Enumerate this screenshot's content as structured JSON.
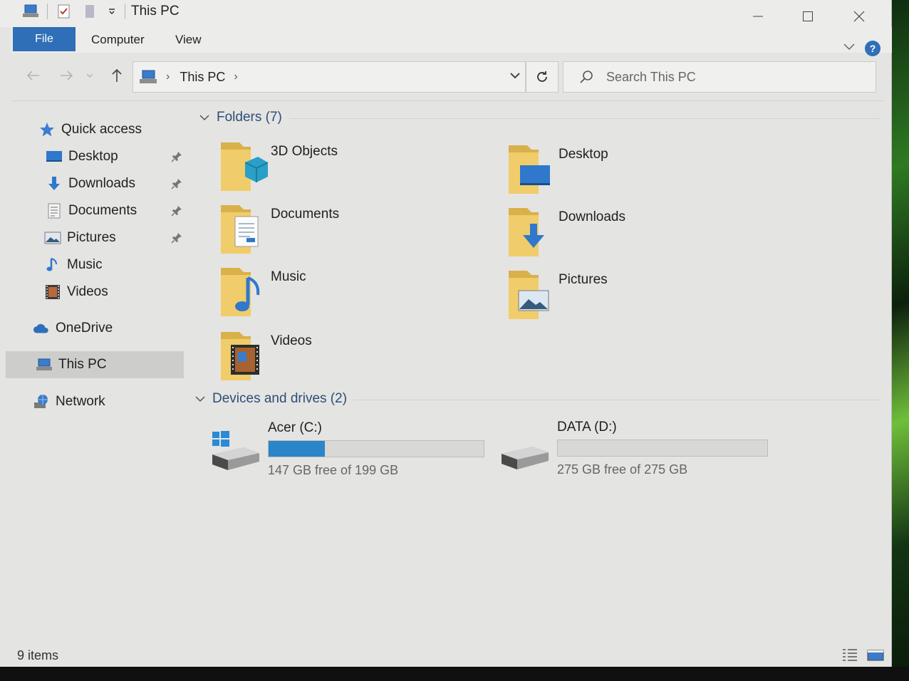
{
  "window": {
    "title": "This PC",
    "controls": {
      "minimize": "─",
      "maximize": "☐",
      "close": "✕"
    }
  },
  "ribbon": {
    "tabs": [
      {
        "label": "File"
      },
      {
        "label": "Computer"
      },
      {
        "label": "View"
      }
    ],
    "help": "?"
  },
  "address": {
    "path": "This PC",
    "search_placeholder": "Search This PC"
  },
  "navpane": {
    "quick_access": "Quick access",
    "items": [
      {
        "label": "Desktop",
        "pinned": true
      },
      {
        "label": "Downloads",
        "pinned": true
      },
      {
        "label": "Documents",
        "pinned": true
      },
      {
        "label": "Pictures",
        "pinned": true
      },
      {
        "label": "Music",
        "pinned": false
      },
      {
        "label": "Videos",
        "pinned": false
      }
    ],
    "onedrive": "OneDrive",
    "this_pc": "This PC",
    "network": "Network"
  },
  "content": {
    "folders_header": "Folders (7)",
    "folders": [
      {
        "name": "3D Objects"
      },
      {
        "name": "Desktop"
      },
      {
        "name": "Documents"
      },
      {
        "name": "Downloads"
      },
      {
        "name": "Music"
      },
      {
        "name": "Pictures"
      },
      {
        "name": "Videos"
      }
    ],
    "drives_header": "Devices and drives (2)",
    "drives": [
      {
        "name": "Acer (C:)",
        "free": "147 GB free of 199 GB",
        "used_fraction": 0.26
      },
      {
        "name": "DATA (D:)",
        "free": "275 GB free of 275 GB",
        "used_fraction": 0.0
      }
    ]
  },
  "status": {
    "items": "9 items"
  },
  "colors": {
    "accent": "#2f6fb8",
    "drive_fill": "#2a86c8",
    "folder": "#e8c15a",
    "window_bg": "#e4e4e2"
  }
}
